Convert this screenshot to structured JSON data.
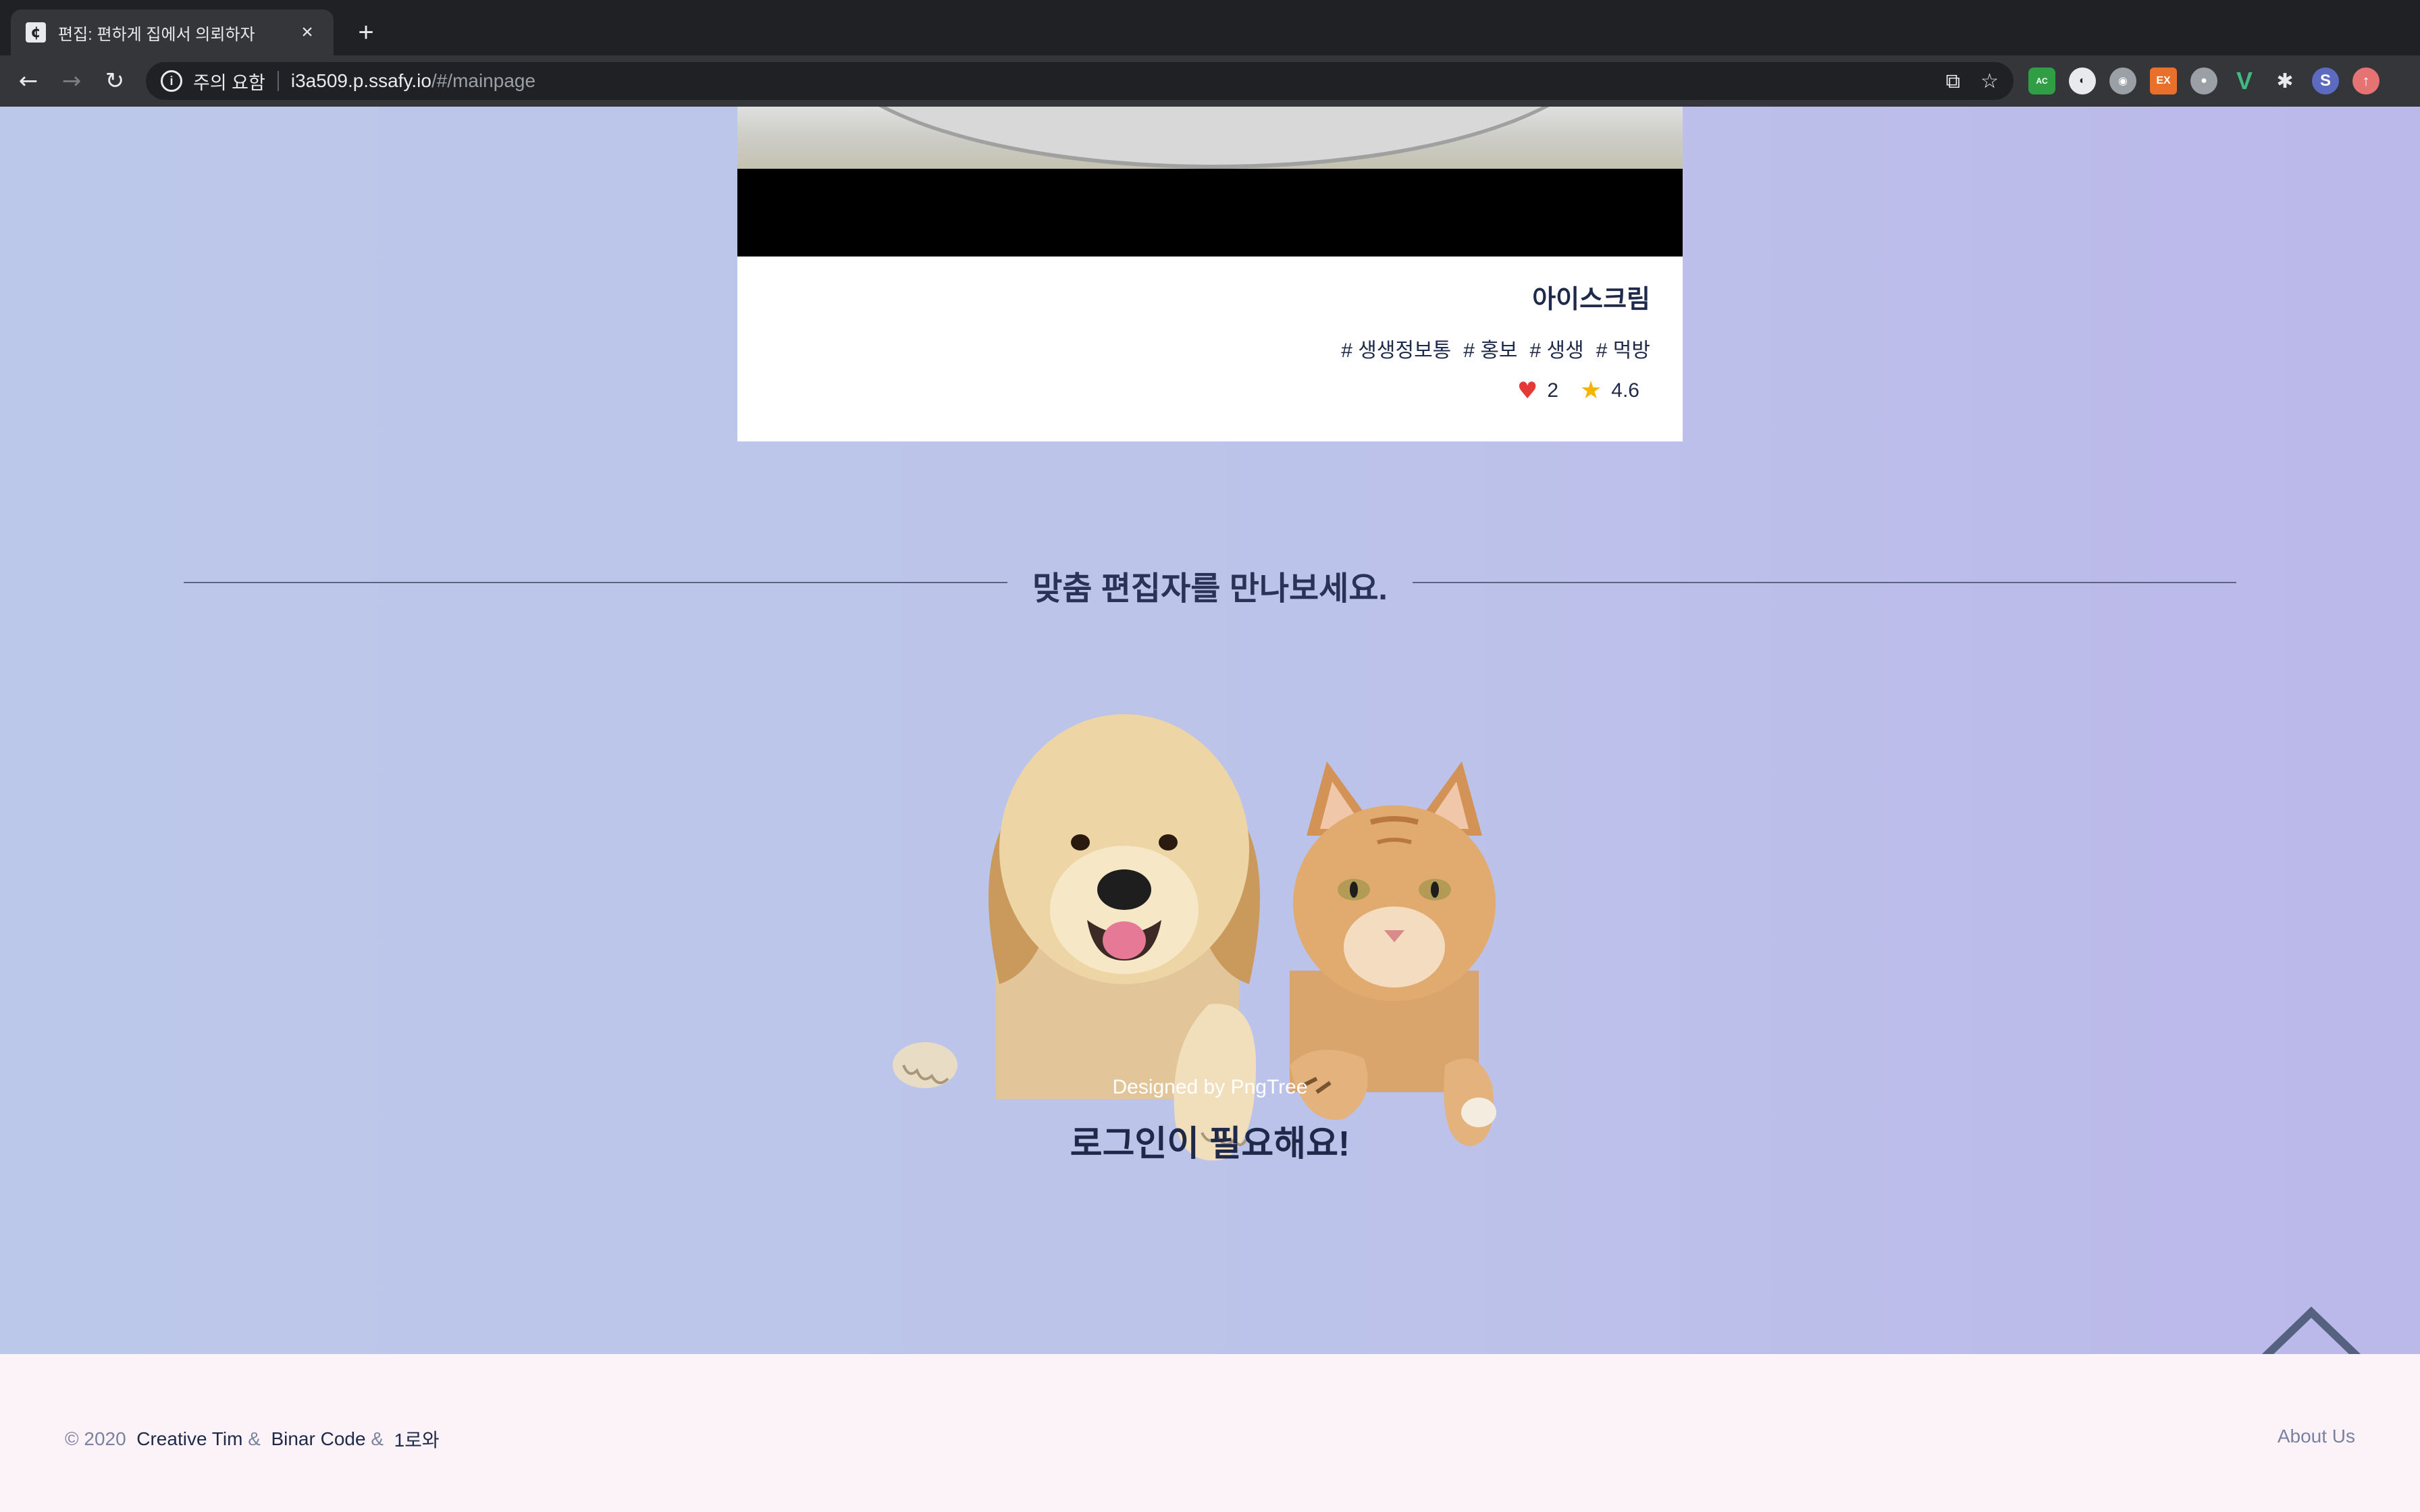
{
  "browser": {
    "tab_title": "편집: 편하게 집에서 의뢰하자",
    "tab_close": "×",
    "new_tab": "+",
    "security_label": "주의 요함",
    "url_host": "i3a509.p.ssafy.io",
    "url_path": "/#/mainpage",
    "extensions": [
      "AC",
      "",
      "",
      "EX",
      "",
      "V",
      "",
      "S",
      ""
    ]
  },
  "card": {
    "title": "아이스크림",
    "tags": [
      "# 생생정보통",
      "# 홍보",
      "# 생생",
      "# 먹방"
    ],
    "likes": "2",
    "rating": "4.6"
  },
  "section": {
    "title": "맞춤 편집자를 만나보세요."
  },
  "illustration": {
    "credit": "Designed by PngTree"
  },
  "login_message": "로그인이 필요해요!",
  "footer": {
    "copyright": "© 2020",
    "link1": "Creative Tim",
    "sep": "&",
    "link2": "Binar Code",
    "link3": "1로와",
    "about": "About Us"
  }
}
